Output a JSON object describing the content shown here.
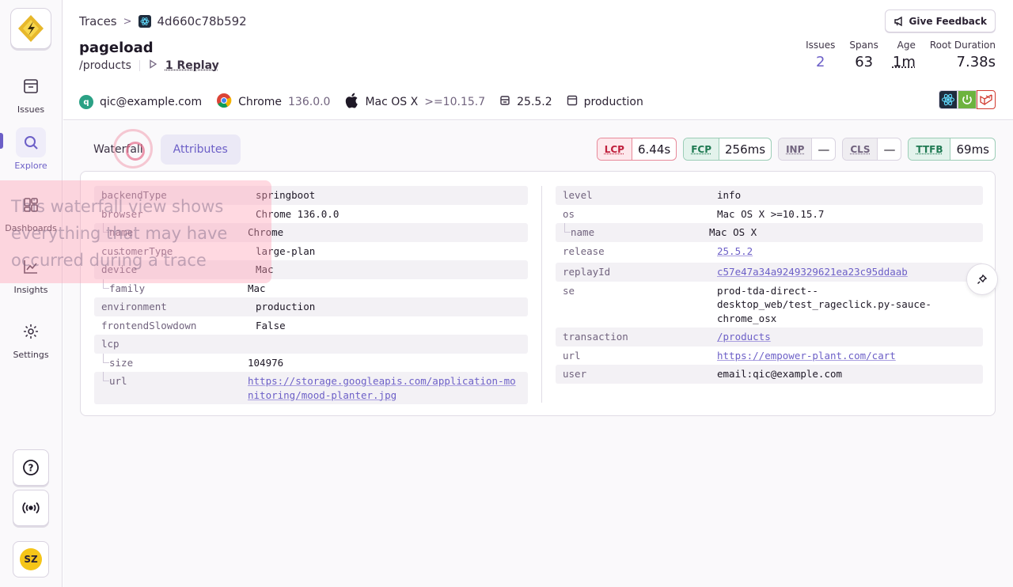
{
  "sidebar": {
    "items": [
      {
        "label": "Issues",
        "icon": "inbox-icon"
      },
      {
        "label": "Explore",
        "icon": "search-icon"
      },
      {
        "label": "Dashboards",
        "icon": "dashboards-icon"
      },
      {
        "label": "Insights",
        "icon": "insights-icon"
      },
      {
        "label": "Settings",
        "icon": "gear-icon"
      }
    ],
    "active_color": "#6c5fc7",
    "avatar_initials": "SZ"
  },
  "tour": {
    "text": "This waterfall view shows everything that may have occurred during a trace"
  },
  "header": {
    "breadcrumb_root": "Traces",
    "trace_id": "4d660c78b592",
    "title": "pageload",
    "path": "/products",
    "replay_label": "1 Replay",
    "feedback_label": "Give Feedback",
    "stats": [
      {
        "label": "Issues",
        "value": "2"
      },
      {
        "label": "Spans",
        "value": "63"
      },
      {
        "label": "Age",
        "value": "1m"
      },
      {
        "label": "Root Duration",
        "value": "7.38s"
      }
    ],
    "context": {
      "user_initial": "q",
      "user": "qic@example.com",
      "browser": "Chrome",
      "browser_version": "136.0.0",
      "os": "Mac OS X",
      "os_version": ">=10.15.7",
      "release": "25.5.2",
      "environment": "production"
    }
  },
  "tabs": [
    {
      "label": "Waterfall",
      "active": false
    },
    {
      "label": "Attributes",
      "active": true
    }
  ],
  "vitals": [
    {
      "name": "LCP",
      "value": "6.44s",
      "status": "bad"
    },
    {
      "name": "FCP",
      "value": "256ms",
      "status": "good"
    },
    {
      "name": "INP",
      "value": "—",
      "status": "none"
    },
    {
      "name": "CLS",
      "value": "—",
      "status": "none"
    },
    {
      "name": "TTFB",
      "value": "69ms",
      "status": "good"
    }
  ],
  "attributes_left": [
    {
      "key": "backendType",
      "value": "springboot"
    },
    {
      "key": "browser",
      "value": "Chrome 136.0.0"
    },
    {
      "key": "name",
      "value": "Chrome"
    },
    {
      "key": "customerType",
      "value": "large-plan"
    },
    {
      "key": "device",
      "value": "Mac"
    },
    {
      "key": "family",
      "value": "Mac"
    },
    {
      "key": "environment",
      "value": "production"
    },
    {
      "key": "frontendSlowdown",
      "value": "False"
    },
    {
      "key": "lcp",
      "value": ""
    },
    {
      "key": "size",
      "value": "104976"
    },
    {
      "key": "url",
      "value": "https://storage.googleapis.com/application-monitoring/mood-planter.jpg"
    }
  ],
  "attributes_right": [
    {
      "key": "level",
      "value": "info"
    },
    {
      "key": "os",
      "value": "Mac OS X >=10.15.7"
    },
    {
      "key": "name",
      "value": "Mac OS X"
    },
    {
      "key": "release",
      "value": "25.5.2"
    },
    {
      "key": "replayId",
      "value": "c57e47a34a9249329621ea23c95ddaab"
    },
    {
      "key": "se",
      "value": "prod-tda-direct--desktop_web/test_rageclick.py-sauce-chrome_osx"
    },
    {
      "key": "transaction",
      "value": "/products"
    },
    {
      "key": "url",
      "value": "https://empower-plant.com/cart"
    },
    {
      "key": "user",
      "value": "email:qic@example.com"
    }
  ]
}
